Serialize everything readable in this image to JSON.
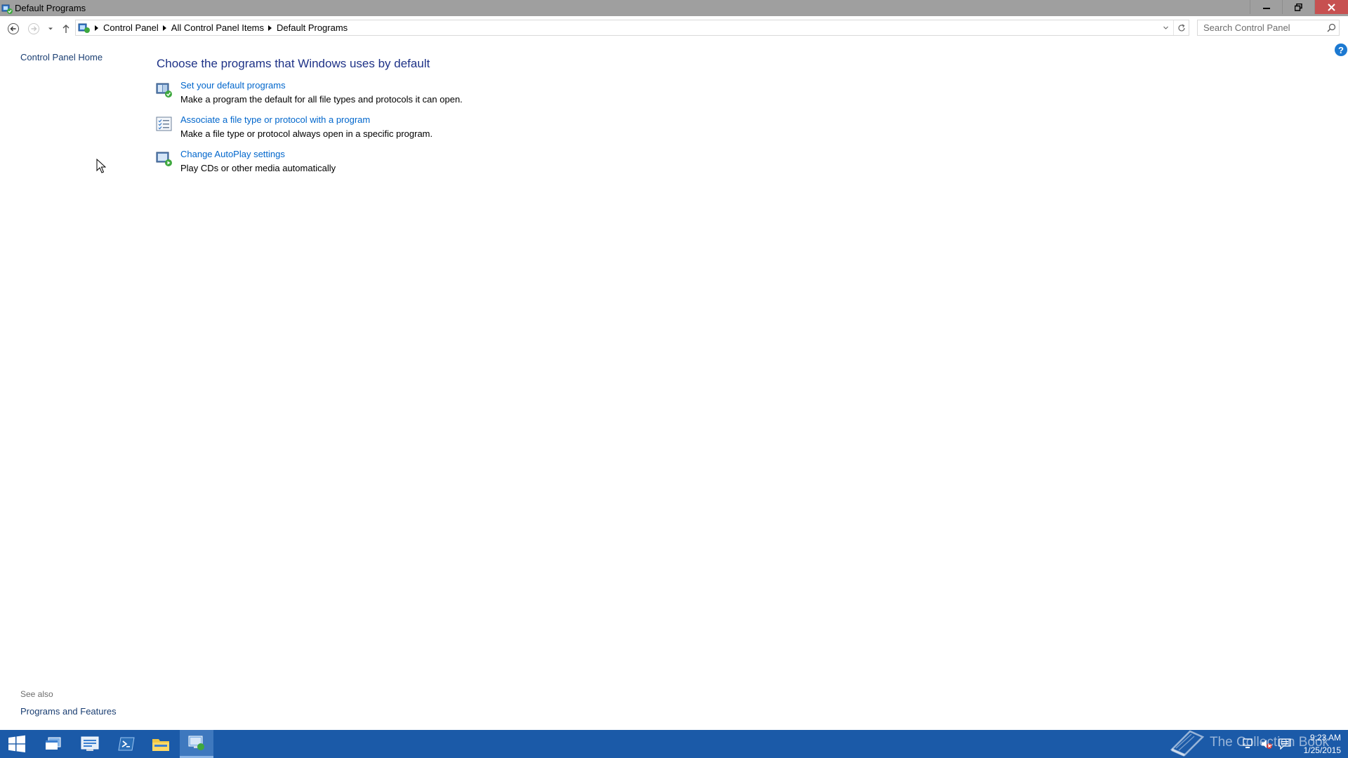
{
  "window": {
    "title": "Default Programs"
  },
  "address": {
    "crumbs": [
      "Control Panel",
      "All Control Panel Items",
      "Default Programs"
    ]
  },
  "search": {
    "placeholder": "Search Control Panel"
  },
  "left_pane": {
    "home_link": "Control Panel Home",
    "see_also_label": "See also",
    "see_also_link": "Programs and Features"
  },
  "main": {
    "heading": "Choose the programs that Windows uses by default",
    "tasks": [
      {
        "link": "Set your default programs",
        "desc": "Make a program the default for all file types and protocols it can open.",
        "icon": "default-programs-icon"
      },
      {
        "link": "Associate a file type or protocol with a program",
        "desc": "Make a file type or protocol always open in a specific program.",
        "icon": "file-association-icon"
      },
      {
        "link": "Change AutoPlay settings",
        "desc": "Play CDs or other media automatically",
        "icon": "autoplay-icon"
      }
    ]
  },
  "taskbar": {
    "watermark": "The Collection Book",
    "clock_time": "9:23 AM",
    "clock_date": "1/25/2015"
  },
  "colors": {
    "titlebar": "#9f9f9f",
    "close_button": "#c75050",
    "link": "#0066cc",
    "heading": "#1e3287",
    "taskbar": "#1b5aa8"
  }
}
